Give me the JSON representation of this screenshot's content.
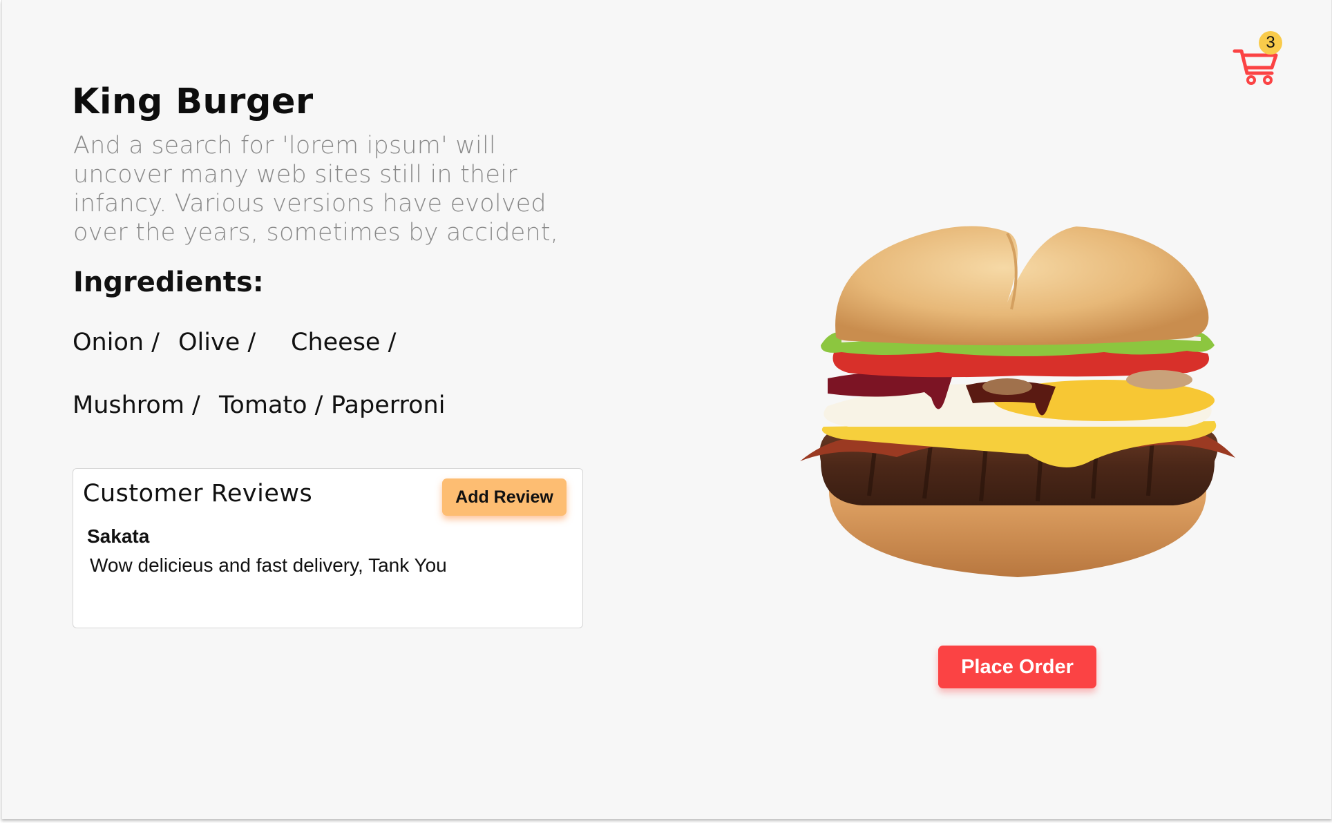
{
  "product": {
    "title": "King Burger",
    "description": "And a search for 'lorem ipsum' will uncover many web sites still in their infancy. Various versions have evolved over the years, sometimes by accident,",
    "ingredients_heading": "Ingredients:",
    "ingredients": [
      "Onion /",
      "Olive /",
      "Cheese /",
      "Mushrom /",
      "Tomato /",
      "Paperroni"
    ]
  },
  "reviews": {
    "title": "Customer Reviews",
    "add_label": "Add Review",
    "items": [
      {
        "name": "Sakata",
        "text": "Wow delicieus and fast delivery, Tank You"
      }
    ]
  },
  "cart": {
    "icon": "shopping-cart-icon",
    "count": "3"
  },
  "order": {
    "label": "Place Order"
  },
  "image": {
    "icon": "burger-image"
  },
  "colors": {
    "accent": "#fb4344",
    "review_button": "#fdbd72",
    "badge": "#f9cb4b",
    "background": "#f7f7f7"
  }
}
